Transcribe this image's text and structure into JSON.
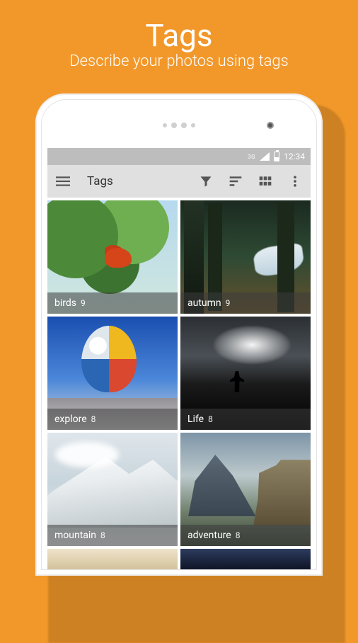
{
  "promo": {
    "title": "Tags",
    "subtitle": "Describe your photos using tags"
  },
  "status_bar": {
    "network_label": "3G",
    "time": "12:34"
  },
  "app_bar": {
    "title": "Tags"
  },
  "tags": [
    {
      "name": "birds",
      "count": "9",
      "scene": "birds"
    },
    {
      "name": "autumn",
      "count": "9",
      "scene": "autumn"
    },
    {
      "name": "explore",
      "count": "8",
      "scene": "explore"
    },
    {
      "name": "Life",
      "count": "8",
      "scene": "life"
    },
    {
      "name": "mountain",
      "count": "8",
      "scene": "mountain"
    },
    {
      "name": "adventure",
      "count": "8",
      "scene": "adventure"
    }
  ]
}
